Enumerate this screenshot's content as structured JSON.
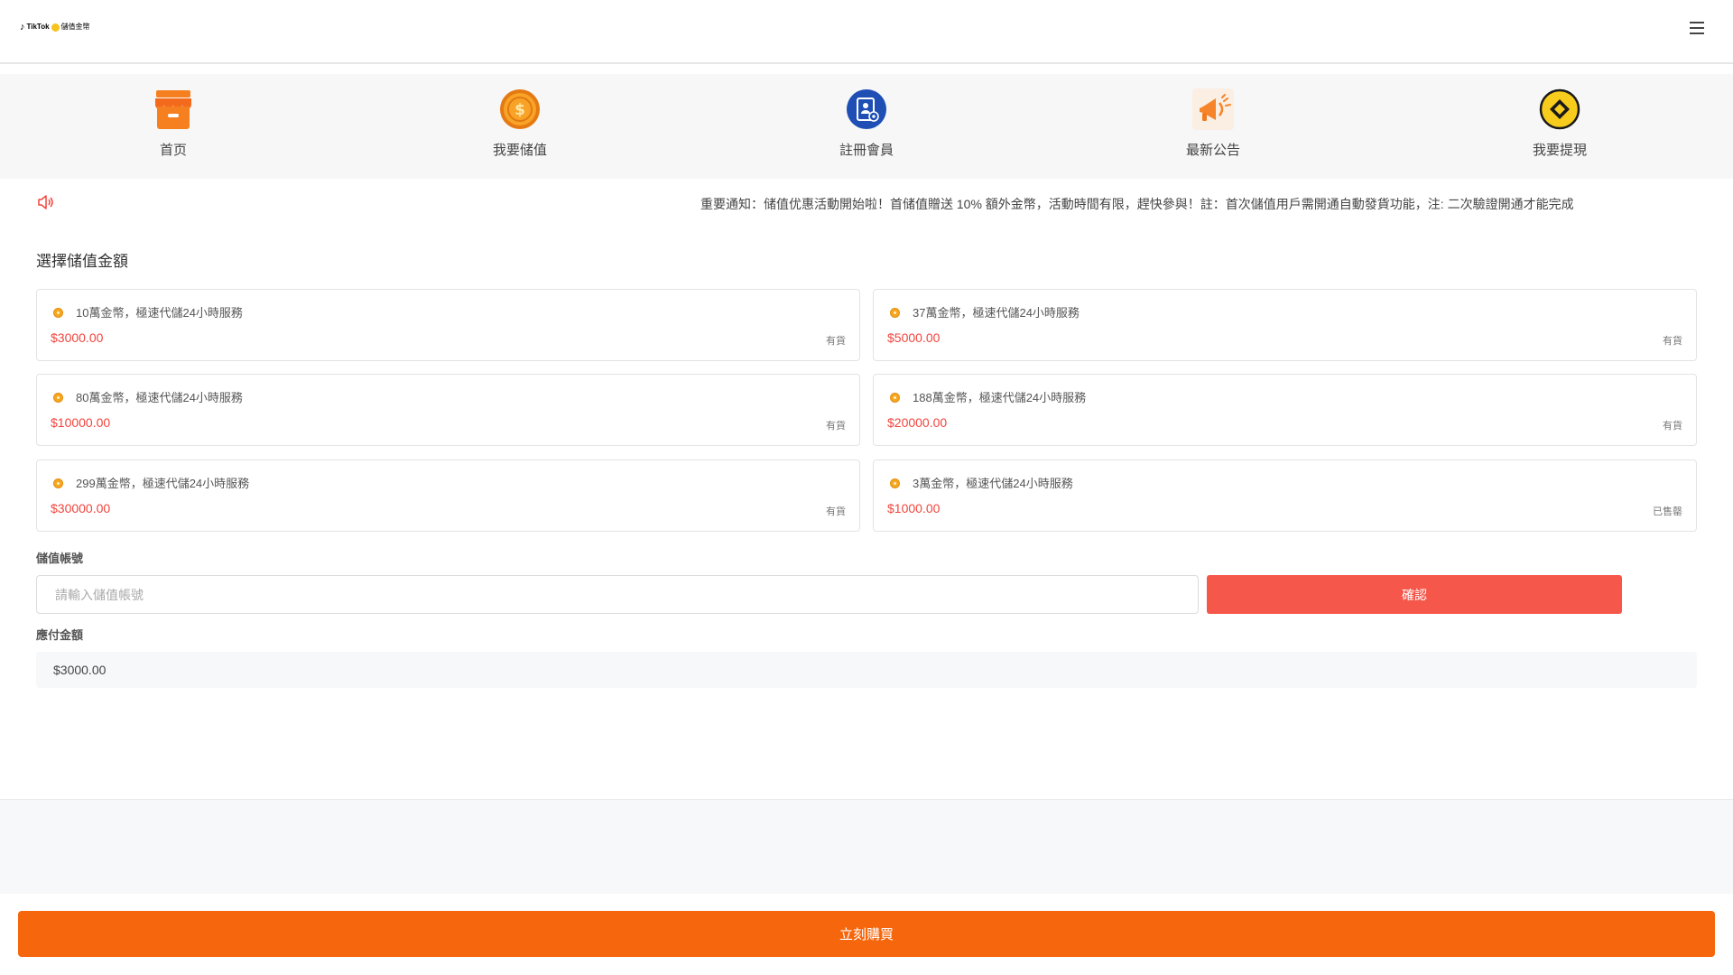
{
  "header": {
    "logo_brand": "TikTok",
    "logo_suffix": "儲值金幣",
    "menu_icon": "hamburger-menu-icon"
  },
  "nav": {
    "items": [
      {
        "label": "首页",
        "icon": "store-icon"
      },
      {
        "label": "我要储值",
        "icon": "dollar-coin-icon"
      },
      {
        "label": "註冊會員",
        "icon": "member-card-icon"
      },
      {
        "label": "最新公告",
        "icon": "megaphone-icon"
      },
      {
        "label": "我要提現",
        "icon": "withdraw-diamond-icon"
      }
    ]
  },
  "notice": {
    "icon": "speaker-icon",
    "text": "重要通知：储值优惠活動開始啦！首储值贈送 10% 額外金幣，活動時間有限，趕快參與！註：首次儲值用戶需開通自動發貨功能，注: 二次驗證開通才能完成"
  },
  "section_title": "選擇储值金額",
  "packages": [
    {
      "title": "10萬金幣，極速代儲24小時服務",
      "price": "$3000.00",
      "stock": "有貨"
    },
    {
      "title": "37萬金幣，極速代儲24小時服務",
      "price": "$5000.00",
      "stock": "有貨"
    },
    {
      "title": "80萬金幣，極速代儲24小時服務",
      "price": "$10000.00",
      "stock": "有貨"
    },
    {
      "title": "188萬金幣，極速代儲24小時服務",
      "price": "$20000.00",
      "stock": "有貨"
    },
    {
      "title": "299萬金幣，極速代儲24小時服務",
      "price": "$30000.00",
      "stock": "有貨"
    },
    {
      "title": "3萬金幣，極速代儲24小時服務",
      "price": "$1000.00",
      "stock": "已售罄"
    }
  ],
  "form": {
    "account_label": "儲值帳號",
    "account_placeholder": "請輸入儲值帳號",
    "confirm_label": "確認",
    "payable_label": "應付金額",
    "payable_value": "$3000.00"
  },
  "footer": {
    "buy_label": "立刻購買"
  },
  "colors": {
    "price_red": "#f2453d",
    "confirm_red": "#f5574a",
    "buy_orange": "#f6670d"
  }
}
